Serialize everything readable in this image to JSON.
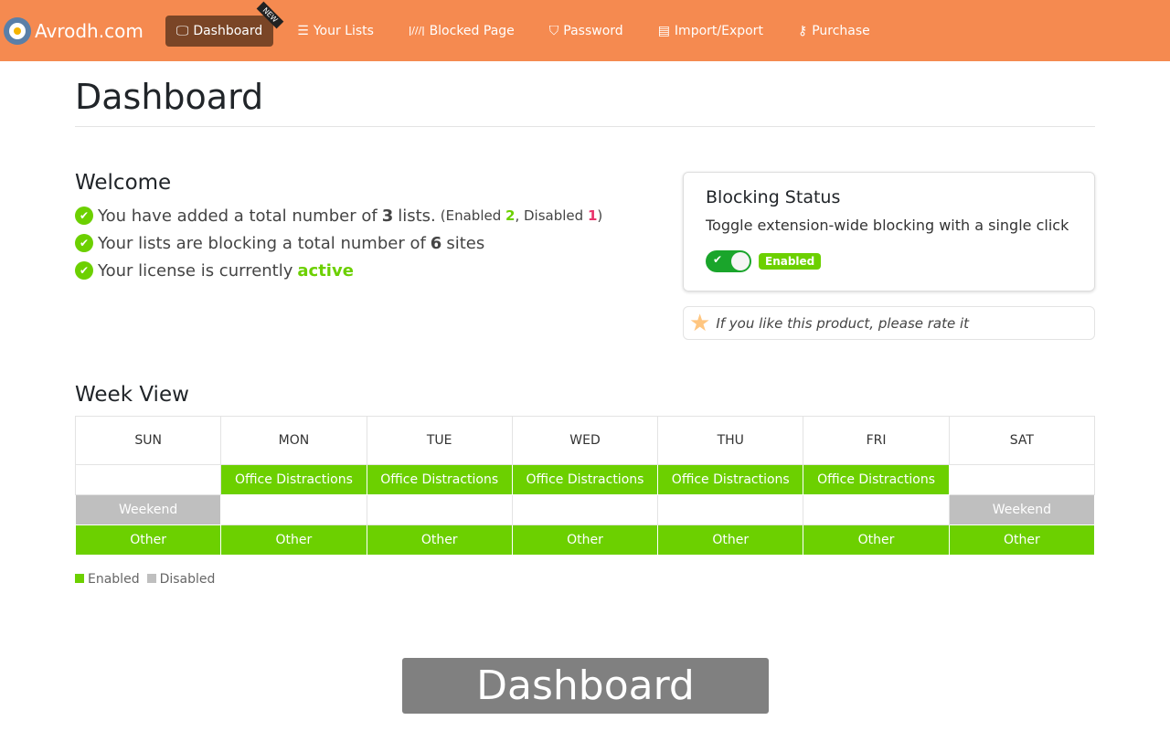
{
  "nav": {
    "brand": "Avrodh.com",
    "items": [
      {
        "label": "Dashboard",
        "icon": "monitor-icon",
        "active": true,
        "tag": "NEW"
      },
      {
        "label": "Your Lists",
        "icon": "list-icon"
      },
      {
        "label": "Blocked Page",
        "icon": "barrier-icon"
      },
      {
        "label": "Password",
        "icon": "shield-icon"
      },
      {
        "label": "Import/Export",
        "icon": "archive-icon"
      },
      {
        "label": "Purchase",
        "icon": "key-icon"
      }
    ]
  },
  "page_title": "Dashboard",
  "welcome": {
    "title": "Welcome",
    "l1_pre": "You have added a total number of",
    "l1_count": "3",
    "l1_post": "lists.",
    "enabled_label": "(Enabled",
    "enabled_count": "2",
    "disabled_label": ", Disabled",
    "disabled_count": "1",
    "close": ")",
    "l2_pre": "Your lists are blocking a total number of",
    "l2_count": "6",
    "l2_post": "sites",
    "l3_pre": "Your license is currently",
    "l3_status": "active"
  },
  "blocking": {
    "title": "Blocking Status",
    "desc": "Toggle extension-wide blocking with a single click",
    "state": "Enabled",
    "on": true
  },
  "rate": "If you like this product, please rate it",
  "week": {
    "title": "Week View",
    "days": [
      "SUN",
      "MON",
      "TUE",
      "WED",
      "THU",
      "FRI",
      "SAT"
    ],
    "rows": [
      [
        "",
        "Office Distractions",
        "Office Distractions",
        "Office Distractions",
        "Office Distractions",
        "Office Distractions",
        ""
      ],
      [
        "Weekend",
        "",
        "",
        "",
        "",
        "",
        "Weekend"
      ],
      [
        "Other",
        "Other",
        "Other",
        "Other",
        "Other",
        "Other",
        "Other"
      ]
    ],
    "status": [
      [
        "",
        "en",
        "en",
        "en",
        "en",
        "en",
        ""
      ],
      [
        "dis",
        "",
        "",
        "",
        "",
        "",
        "dis"
      ],
      [
        "en",
        "en",
        "en",
        "en",
        "en",
        "en",
        "en"
      ]
    ],
    "legend": {
      "enabled": "Enabled",
      "disabled": "Disabled"
    }
  },
  "colors": {
    "nav": "#f58a50",
    "enabled": "#6cd000",
    "disabled": "#bfbfbf"
  },
  "overlay": "Dashboard"
}
